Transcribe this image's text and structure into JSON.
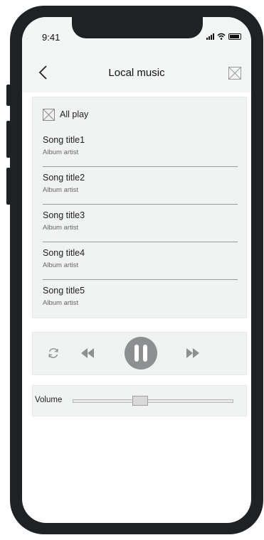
{
  "status_bar": {
    "time": "9:41"
  },
  "nav": {
    "title": "Local music"
  },
  "list": {
    "all_play_label": "All play",
    "songs": [
      {
        "title": "Song title1",
        "artist": "Album artist"
      },
      {
        "title": "Song title2",
        "artist": "Album artist"
      },
      {
        "title": "Song title3",
        "artist": "Album artist"
      },
      {
        "title": "Song title4",
        "artist": "Album artist"
      },
      {
        "title": "Song title5",
        "artist": "Album artist"
      }
    ]
  },
  "player": {
    "state": "playing",
    "icons": [
      "repeat-icon",
      "previous-icon",
      "pause-icon",
      "next-icon"
    ]
  },
  "volume": {
    "label": "Volume",
    "level": 0.42
  },
  "colors": {
    "frame": "#1f2224",
    "panel": "#f1f2f2",
    "control_gray": "#8d8f90",
    "pause_button": "#8e8f90"
  }
}
